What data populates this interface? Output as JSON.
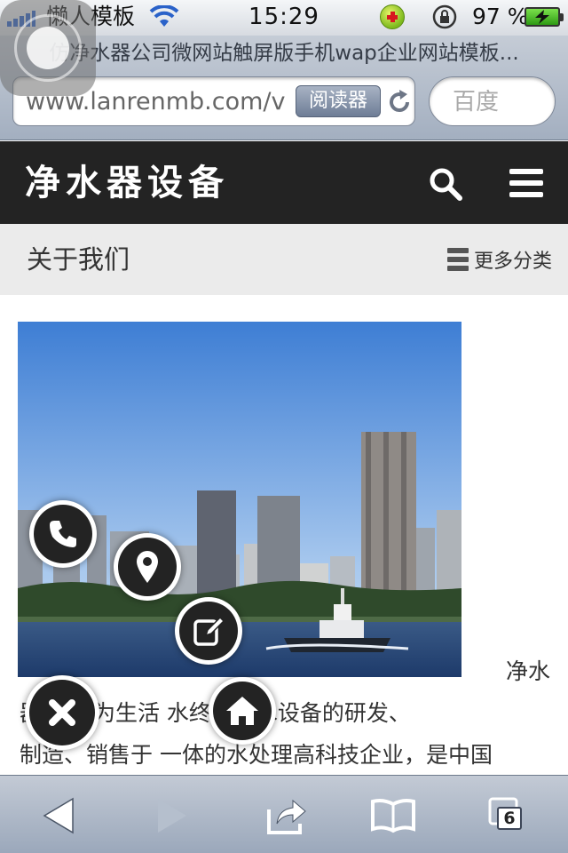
{
  "status_bar": {
    "carrier": "懒人模板",
    "time": "15:29",
    "battery_percent": "97 %"
  },
  "browser": {
    "page_title": "仿净水器公司微网站触屏版手机wap企业网站模板...",
    "url": "www.lanrenmb.com/v",
    "reader_label": "阅读器",
    "search_placeholder": "百度",
    "tab_count": "6"
  },
  "site": {
    "logo": "净水器设备",
    "breadcrumb_title": "关于我们",
    "more_categories": "更多分类"
  },
  "content": {
    "text_lead": "净水",
    "text_line2": "器  ，作为生活    水终端净水设备的研发、",
    "text_line3": "制造、销售于 一体的水处理高科技企业，是中国"
  },
  "colors": {
    "header_bg": "#232323",
    "crumb_bg": "#ebebeb",
    "fab_bg": "#232323"
  }
}
